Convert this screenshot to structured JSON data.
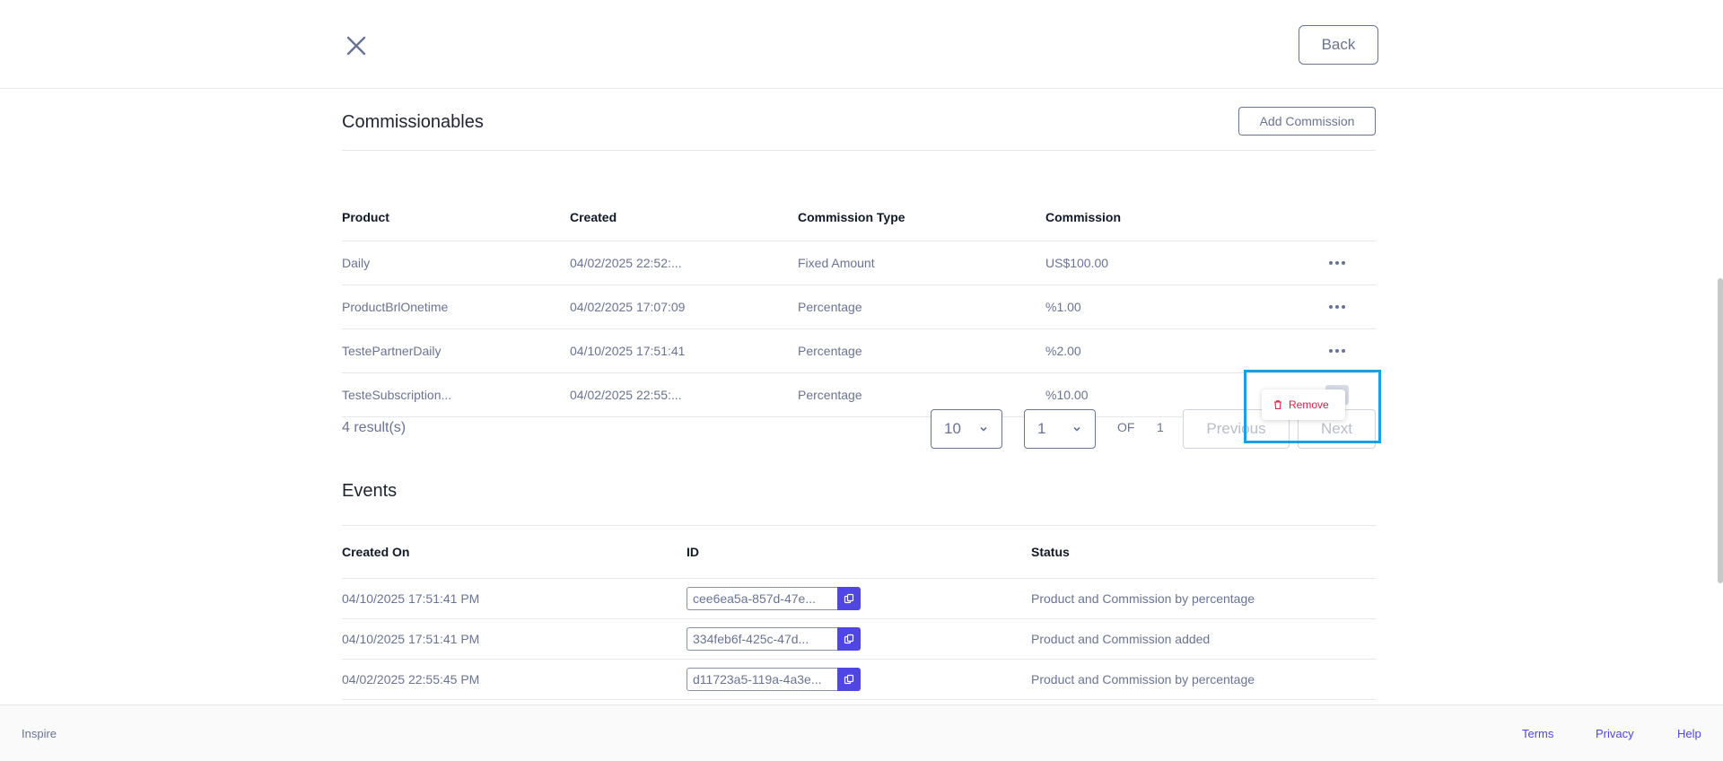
{
  "header": {
    "back_label": "Back"
  },
  "commissionables": {
    "title": "Commissionables",
    "add_label": "Add Commission",
    "columns": [
      "Product",
      "Created",
      "Commission Type",
      "Commission"
    ],
    "rows": [
      {
        "product": "Daily",
        "created": "04/02/2025 22:52:...",
        "type": "Fixed Amount",
        "commission": "US$100.00"
      },
      {
        "product": "ProductBrlOnetime",
        "created": "04/02/2025 17:07:09",
        "type": "Percentage",
        "commission": "%1.00"
      },
      {
        "product": "TestePartnerDaily",
        "created": "04/10/2025 17:51:41",
        "type": "Percentage",
        "commission": "%2.00"
      },
      {
        "product": "TesteSubscription...",
        "created": "04/02/2025 22:55:...",
        "type": "Percentage",
        "commission": "%10.00"
      }
    ],
    "row_menu": {
      "remove_label": "Remove"
    }
  },
  "pagination": {
    "results": "4 result(s)",
    "page_size": "10",
    "current_page": "1",
    "of_label": "OF",
    "total_pages": "1",
    "previous_label": "Previous",
    "next_label": "Next"
  },
  "events": {
    "title": "Events",
    "columns": [
      "Created On",
      "ID",
      "Status"
    ],
    "rows": [
      {
        "created_on": "04/10/2025 17:51:41 PM",
        "id": "cee6ea5a-857d-47e...",
        "status": "Product and Commission by percentage"
      },
      {
        "created_on": "04/10/2025 17:51:41 PM",
        "id": "334feb6f-425c-47d...",
        "status": "Product and Commission added"
      },
      {
        "created_on": "04/02/2025 22:55:45 PM",
        "id": "d11723a5-119a-4a3e...",
        "status": "Product and Commission by percentage"
      }
    ]
  },
  "footer": {
    "brand": "Inspire",
    "terms": "Terms",
    "privacy": "Privacy",
    "help": "Help"
  },
  "colors": {
    "accent": "#4f46e5",
    "muted_text": "#6b7393",
    "danger": "#e11d48",
    "highlight": "#1aa0e6"
  }
}
